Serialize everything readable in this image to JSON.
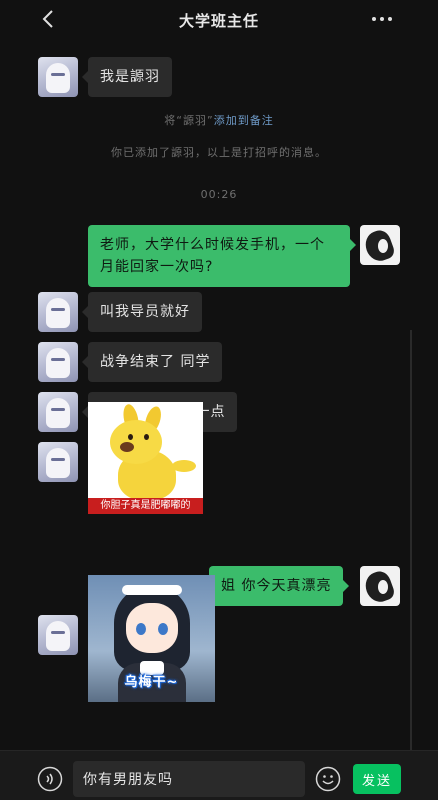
{
  "header": {
    "title": "大学班主任",
    "back_icon": "chevron-left-icon",
    "more_icon": "more-dots-icon"
  },
  "messages": [
    {
      "side": "left",
      "type": "text",
      "text": "我是謜羽"
    },
    {
      "side": "system",
      "type": "remark",
      "prefix": "将“謜羽”",
      "link": "添加到备注"
    },
    {
      "side": "system",
      "type": "notice",
      "text": "你已添加了謜羽，以上是打招呼的消息。"
    },
    {
      "side": "system",
      "type": "time",
      "text": "00:26"
    },
    {
      "side": "right",
      "type": "text",
      "text": "老师，大学什么时候发手机，一个月能回家一次吗?"
    },
    {
      "side": "left",
      "type": "text",
      "text": "叫我导员就好"
    },
    {
      "side": "left",
      "type": "text",
      "text": "战争结束了 同学"
    },
    {
      "side": "left",
      "type": "text",
      "text": "大学了 胆子大一点"
    },
    {
      "side": "left",
      "type": "sticker",
      "caption": "你胆子真是肥嘟嘟的"
    },
    {
      "side": "right",
      "type": "text",
      "text": "姐 你今天真漂亮"
    },
    {
      "side": "left",
      "type": "sticker",
      "caption": "乌梅干~"
    }
  ],
  "input": {
    "value": "你有男朋友吗",
    "send_label": "发送",
    "voice_icon": "voice-icon",
    "emoji_icon": "emoji-icon"
  },
  "colors": {
    "background": "#111111",
    "bubble_left": "#2b2b2b",
    "bubble_right": "#3bbc6b",
    "send_button": "#07c160",
    "link": "#6f9bc9"
  }
}
